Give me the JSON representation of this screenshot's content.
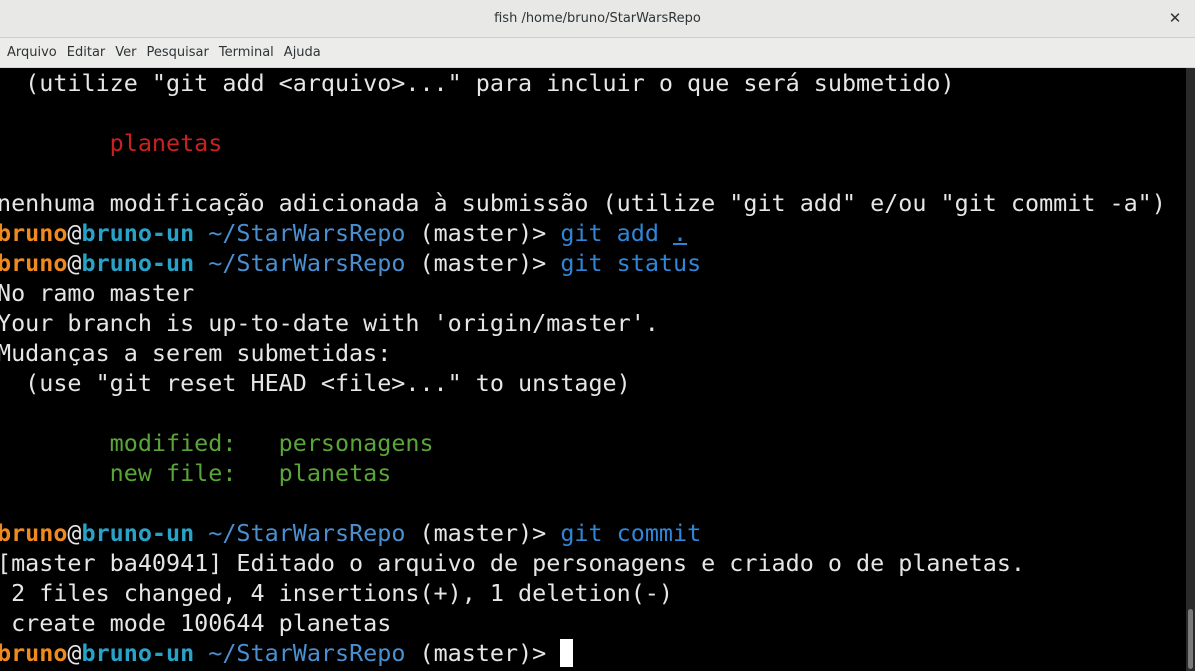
{
  "window": {
    "title": "fish  /home/bruno/StarWarsRepo",
    "close_glyph": "✕"
  },
  "menu": [
    "Arquivo",
    "Editar",
    "Ver",
    "Pesquisar",
    "Terminal",
    "Ajuda"
  ],
  "prompt": {
    "user": "bruno",
    "at": "@",
    "host": "bruno-un",
    "path": " ~/StarWarsRepo",
    "branch": " (master)> "
  },
  "colors": {
    "red": "#cc2020",
    "green": "#5aa538",
    "user": "#f08a1e",
    "host": "#29a2c8",
    "command": "#2f86d8"
  },
  "terminal": {
    "l1": "  (utilize \"git add <arquivo>...\" para incluir o que será submetido)",
    "l2_indent": "        ",
    "l2_text": "planetas",
    "l3": "nenhuma modificação adicionada à submissão (utilize \"git add\" e/ou \"git commit -a\")",
    "cmd1": "git add ",
    "cmd1_arg": ".",
    "cmd2": "git status",
    "l6": "No ramo master",
    "l7": "Your branch is up-to-date with 'origin/master'.",
    "l8": "Mudanças a serem submetidas:",
    "l9": "  (use \"git reset HEAD <file>...\" to unstage)",
    "l10_indent": "        ",
    "l10_text": "modified:   personagens",
    "l11_indent": "        ",
    "l11_text": "new file:   planetas",
    "cmd3": "git commit",
    "l13": "[master ba40941] Editado o arquivo de personagens e criado o de planetas.",
    "l14": " 2 files changed, 4 insertions(+), 1 deletion(-)",
    "l15": " create mode 100644 planetas"
  }
}
